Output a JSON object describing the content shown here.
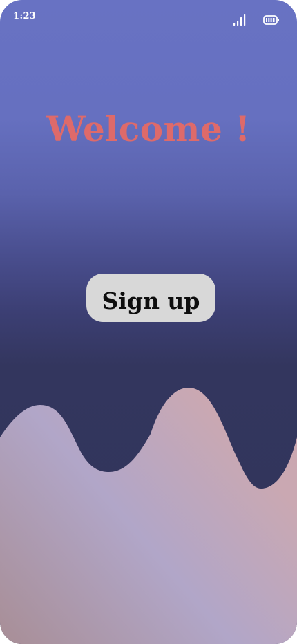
{
  "status_bar": {
    "time": "1:23",
    "signal_icon": "cellular-signal-icon",
    "battery_icon": "battery-full-icon"
  },
  "welcome": {
    "title": "Welcome !"
  },
  "signup": {
    "label": "Sign up"
  },
  "colors": {
    "background_top": "#6872c3",
    "background_bottom": "#31345a",
    "title": "#de6a6a",
    "button": "#d8d8d8",
    "wave_lavender": "#b1a6c8",
    "wave_pink": "#caa8b2",
    "wave_mauve": "#a88e96"
  }
}
